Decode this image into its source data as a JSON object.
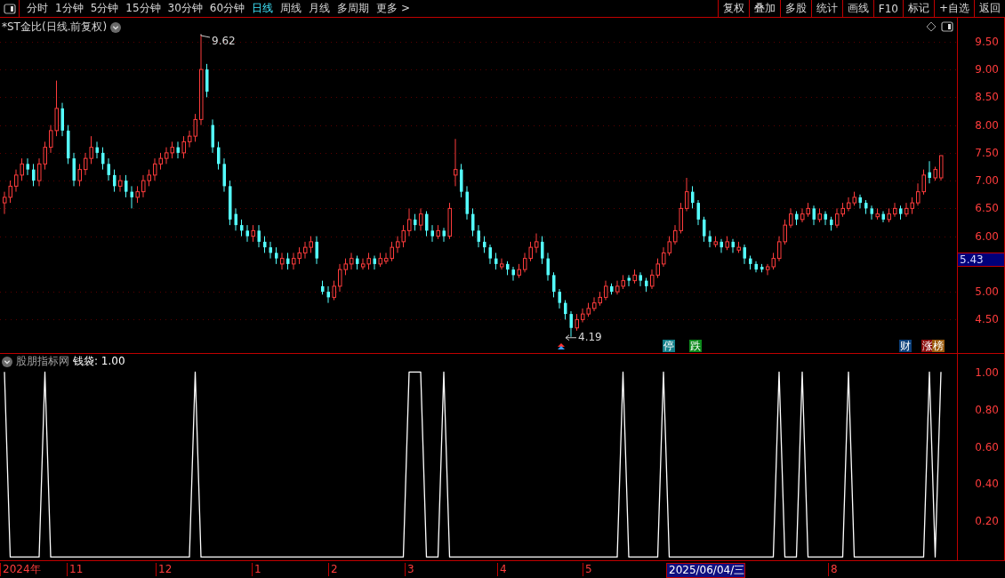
{
  "toolbar": {
    "periods": [
      {
        "label": "分时",
        "selected": false
      },
      {
        "label": "1分钟",
        "selected": false
      },
      {
        "label": "5分钟",
        "selected": false
      },
      {
        "label": "15分钟",
        "selected": false
      },
      {
        "label": "30分钟",
        "selected": false
      },
      {
        "label": "60分钟",
        "selected": false
      },
      {
        "label": "日线",
        "selected": true
      },
      {
        "label": "周线",
        "selected": false
      },
      {
        "label": "月线",
        "selected": false
      },
      {
        "label": "多周期",
        "selected": false
      },
      {
        "label": "更多 >",
        "selected": false
      }
    ],
    "buttons": [
      "复权",
      "叠加",
      "多股",
      "统计",
      "画线",
      "F10",
      "标记",
      "+自选",
      "返回"
    ]
  },
  "main_chart": {
    "title": "*ST金比(日线.前复权)",
    "high_label": "9.62",
    "low_label": "4.19",
    "current_price": "5.43",
    "badges": [
      {
        "label": "停",
        "color": "#12808a"
      },
      {
        "label": "跌",
        "color": "#0d8a1c"
      },
      {
        "label": "财",
        "color": "#0b3f7a"
      },
      {
        "label": "涨",
        "color": "#8a0d0d"
      },
      {
        "label": "榜",
        "color": "#9a5a0c"
      }
    ],
    "chart_data": {
      "type": "candlestick",
      "grid": true,
      "ylim": [
        3.89,
        9.93
      ],
      "yticks": [
        {
          "value": 9.5,
          "label": "9.50"
        },
        {
          "value": 9,
          "label": "9.00"
        },
        {
          "value": 8.5,
          "label": "8.50"
        },
        {
          "value": 8,
          "label": "8.00"
        },
        {
          "value": 7.5,
          "label": "7.50"
        },
        {
          "value": 7,
          "label": "7.00"
        },
        {
          "value": 6.5,
          "label": "6.50"
        },
        {
          "value": 6,
          "label": "6.00"
        },
        {
          "value": 5,
          "label": "5.00"
        },
        {
          "value": 4.5,
          "label": "4.50"
        }
      ],
      "ohlc": [
        [
          6.6,
          6.8,
          6.4,
          6.7
        ],
        [
          6.7,
          7.0,
          6.6,
          6.9
        ],
        [
          6.9,
          7.2,
          6.8,
          7.1
        ],
        [
          7.1,
          7.4,
          7.0,
          7.3
        ],
        [
          7.3,
          7.4,
          7.1,
          7.2
        ],
        [
          7.2,
          7.3,
          6.9,
          7.0
        ],
        [
          7.0,
          7.4,
          6.9,
          7.3
        ],
        [
          7.3,
          7.7,
          7.2,
          7.6
        ],
        [
          7.6,
          8.0,
          7.5,
          7.9
        ],
        [
          7.9,
          8.8,
          7.8,
          8.3
        ],
        [
          8.3,
          8.4,
          7.8,
          7.9
        ],
        [
          7.9,
          8.0,
          7.3,
          7.4
        ],
        [
          7.4,
          7.5,
          6.9,
          7.0
        ],
        [
          7.0,
          7.3,
          6.9,
          7.2
        ],
        [
          7.2,
          7.5,
          7.1,
          7.4
        ],
        [
          7.4,
          7.8,
          7.3,
          7.6
        ],
        [
          7.6,
          7.7,
          7.4,
          7.5
        ],
        [
          7.5,
          7.6,
          7.2,
          7.3
        ],
        [
          7.3,
          7.4,
          7.0,
          7.1
        ],
        [
          7.1,
          7.2,
          6.8,
          6.9
        ],
        [
          6.9,
          7.1,
          6.8,
          7.0
        ],
        [
          7.0,
          7.1,
          6.7,
          6.8
        ],
        [
          6.8,
          6.9,
          6.5,
          6.7
        ],
        [
          6.7,
          6.9,
          6.6,
          6.8
        ],
        [
          6.8,
          7.1,
          6.7,
          7.0
        ],
        [
          7.0,
          7.2,
          6.9,
          7.1
        ],
        [
          7.1,
          7.4,
          7.0,
          7.3
        ],
        [
          7.3,
          7.5,
          7.2,
          7.4
        ],
        [
          7.4,
          7.6,
          7.3,
          7.5
        ],
        [
          7.5,
          7.7,
          7.4,
          7.6
        ],
        [
          7.6,
          7.7,
          7.4,
          7.5
        ],
        [
          7.5,
          7.8,
          7.4,
          7.7
        ],
        [
          7.7,
          7.9,
          7.6,
          7.8
        ],
        [
          7.8,
          8.2,
          7.7,
          8.1
        ],
        [
          8.1,
          9.62,
          8.0,
          9.0
        ],
        [
          9.0,
          9.1,
          8.5,
          8.6
        ],
        [
          8.0,
          8.1,
          7.5,
          7.6
        ],
        [
          7.6,
          7.7,
          7.2,
          7.3
        ],
        [
          7.3,
          7.4,
          6.8,
          6.9
        ],
        [
          6.9,
          7.0,
          6.2,
          6.3
        ],
        [
          6.4,
          6.5,
          6.1,
          6.2
        ],
        [
          6.2,
          6.3,
          6.0,
          6.1
        ],
        [
          6.1,
          6.2,
          5.9,
          6.0
        ],
        [
          6.0,
          6.2,
          5.9,
          6.1
        ],
        [
          6.1,
          6.2,
          5.8,
          5.9
        ],
        [
          5.9,
          6.0,
          5.7,
          5.8
        ],
        [
          5.8,
          5.9,
          5.6,
          5.7
        ],
        [
          5.7,
          5.8,
          5.5,
          5.6
        ],
        [
          5.5,
          5.7,
          5.4,
          5.6
        ],
        [
          5.6,
          5.7,
          5.4,
          5.5
        ],
        [
          5.5,
          5.7,
          5.4,
          5.6
        ],
        [
          5.6,
          5.8,
          5.5,
          5.7
        ],
        [
          5.7,
          5.9,
          5.6,
          5.8
        ],
        [
          5.8,
          6.0,
          5.7,
          5.9
        ],
        [
          5.9,
          6.0,
          5.5,
          5.6
        ],
        [
          5.1,
          5.2,
          4.95,
          5.0
        ],
        [
          5.0,
          5.1,
          4.8,
          4.9
        ],
        [
          4.9,
          5.2,
          4.85,
          5.1
        ],
        [
          5.1,
          5.5,
          5.0,
          5.4
        ],
        [
          5.4,
          5.6,
          5.3,
          5.5
        ],
        [
          5.5,
          5.7,
          5.4,
          5.6
        ],
        [
          5.6,
          5.65,
          5.4,
          5.5
        ],
        [
          5.45,
          5.6,
          5.4,
          5.5
        ],
        [
          5.5,
          5.7,
          5.4,
          5.6
        ],
        [
          5.6,
          5.65,
          5.4,
          5.5
        ],
        [
          5.5,
          5.7,
          5.45,
          5.6
        ],
        [
          5.55,
          5.7,
          5.5,
          5.6
        ],
        [
          5.6,
          5.9,
          5.55,
          5.8
        ],
        [
          5.8,
          6.0,
          5.7,
          5.9
        ],
        [
          5.9,
          6.2,
          5.8,
          6.1
        ],
        [
          6.1,
          6.5,
          6.0,
          6.3
        ],
        [
          6.3,
          6.4,
          6.1,
          6.2
        ],
        [
          6.2,
          6.5,
          6.1,
          6.4
        ],
        [
          6.4,
          6.45,
          6.0,
          6.1
        ],
        [
          6.1,
          6.2,
          5.9,
          6.0
        ],
        [
          6.0,
          6.2,
          5.95,
          6.1
        ],
        [
          6.1,
          6.15,
          5.9,
          6.0
        ],
        [
          6.0,
          6.6,
          5.95,
          6.5
        ],
        [
          7.1,
          7.75,
          6.9,
          7.2
        ],
        [
          7.2,
          7.3,
          6.7,
          6.8
        ],
        [
          6.8,
          6.9,
          6.3,
          6.4
        ],
        [
          6.4,
          6.5,
          6.0,
          6.1
        ],
        [
          6.1,
          6.2,
          5.8,
          5.9
        ],
        [
          5.9,
          6.0,
          5.7,
          5.8
        ],
        [
          5.8,
          5.85,
          5.5,
          5.6
        ],
        [
          5.6,
          5.7,
          5.4,
          5.5
        ],
        [
          5.45,
          5.6,
          5.4,
          5.5
        ],
        [
          5.5,
          5.55,
          5.3,
          5.4
        ],
        [
          5.4,
          5.45,
          5.2,
          5.3
        ],
        [
          5.3,
          5.5,
          5.25,
          5.4
        ],
        [
          5.4,
          5.7,
          5.35,
          5.6
        ],
        [
          5.6,
          5.9,
          5.55,
          5.8
        ],
        [
          5.8,
          6.05,
          5.7,
          5.9
        ],
        [
          5.9,
          6.0,
          5.5,
          5.6
        ],
        [
          5.6,
          5.7,
          5.2,
          5.3
        ],
        [
          5.3,
          5.35,
          4.9,
          5.0
        ],
        [
          5.0,
          5.05,
          4.7,
          4.8
        ],
        [
          4.8,
          4.85,
          4.5,
          4.6
        ],
        [
          4.6,
          4.65,
          4.19,
          4.35
        ],
        [
          4.35,
          4.6,
          4.3,
          4.5
        ],
        [
          4.5,
          4.7,
          4.45,
          4.6
        ],
        [
          4.6,
          4.8,
          4.55,
          4.7
        ],
        [
          4.7,
          4.9,
          4.65,
          4.8
        ],
        [
          4.8,
          5.0,
          4.75,
          4.9
        ],
        [
          4.9,
          5.2,
          4.85,
          5.1
        ],
        [
          5.1,
          5.15,
          4.95,
          5.0
        ],
        [
          5.0,
          5.2,
          4.95,
          5.1
        ],
        [
          5.1,
          5.3,
          5.05,
          5.2
        ],
        [
          5.25,
          5.3,
          5.1,
          5.2
        ],
        [
          5.2,
          5.4,
          5.15,
          5.3
        ],
        [
          5.3,
          5.35,
          5.1,
          5.2
        ],
        [
          5.2,
          5.25,
          5.0,
          5.1
        ],
        [
          5.1,
          5.4,
          5.05,
          5.3
        ],
        [
          5.3,
          5.6,
          5.25,
          5.5
        ],
        [
          5.5,
          5.8,
          5.45,
          5.7
        ],
        [
          5.7,
          6.0,
          5.65,
          5.9
        ],
        [
          5.9,
          6.2,
          5.85,
          6.1
        ],
        [
          6.1,
          6.6,
          6.05,
          6.5
        ],
        [
          6.5,
          7.05,
          6.45,
          6.8
        ],
        [
          6.8,
          6.9,
          6.5,
          6.6
        ],
        [
          6.6,
          6.65,
          6.2,
          6.3
        ],
        [
          6.3,
          6.35,
          5.9,
          6.0
        ],
        [
          6.0,
          6.1,
          5.8,
          5.9
        ],
        [
          5.85,
          6.0,
          5.8,
          5.9
        ],
        [
          5.9,
          5.95,
          5.7,
          5.8
        ],
        [
          5.8,
          6.0,
          5.75,
          5.9
        ],
        [
          5.9,
          5.95,
          5.7,
          5.8
        ],
        [
          5.75,
          5.9,
          5.7,
          5.8
        ],
        [
          5.8,
          5.85,
          5.5,
          5.6
        ],
        [
          5.6,
          5.65,
          5.4,
          5.5
        ],
        [
          5.5,
          5.55,
          5.35,
          5.4
        ],
        [
          5.45,
          5.5,
          5.35,
          5.4
        ],
        [
          5.4,
          5.5,
          5.3,
          5.45
        ],
        [
          5.45,
          5.7,
          5.4,
          5.6
        ],
        [
          5.6,
          6.0,
          5.55,
          5.9
        ],
        [
          5.9,
          6.3,
          5.85,
          6.2
        ],
        [
          6.2,
          6.5,
          6.15,
          6.4
        ],
        [
          6.4,
          6.45,
          6.2,
          6.3
        ],
        [
          6.3,
          6.5,
          6.25,
          6.4
        ],
        [
          6.4,
          6.6,
          6.35,
          6.5
        ],
        [
          6.5,
          6.55,
          6.2,
          6.3
        ],
        [
          6.3,
          6.5,
          6.25,
          6.4
        ],
        [
          6.4,
          6.45,
          6.2,
          6.3
        ],
        [
          6.3,
          6.35,
          6.1,
          6.2
        ],
        [
          6.2,
          6.5,
          6.15,
          6.4
        ],
        [
          6.4,
          6.6,
          6.35,
          6.5
        ],
        [
          6.5,
          6.7,
          6.45,
          6.6
        ],
        [
          6.6,
          6.8,
          6.55,
          6.7
        ],
        [
          6.7,
          6.75,
          6.5,
          6.6
        ],
        [
          6.6,
          6.65,
          6.4,
          6.5
        ],
        [
          6.5,
          6.55,
          6.3,
          6.4
        ],
        [
          6.35,
          6.5,
          6.3,
          6.4
        ],
        [
          6.4,
          6.45,
          6.25,
          6.3
        ],
        [
          6.3,
          6.5,
          6.25,
          6.4
        ],
        [
          6.4,
          6.6,
          6.35,
          6.5
        ],
        [
          6.5,
          6.55,
          6.3,
          6.4
        ],
        [
          6.4,
          6.6,
          6.35,
          6.5
        ],
        [
          6.5,
          6.7,
          6.4,
          6.6
        ],
        [
          6.6,
          6.95,
          6.55,
          6.8
        ],
        [
          6.8,
          7.2,
          6.75,
          7.1
        ],
        [
          7.15,
          7.35,
          6.95,
          7.05
        ],
        [
          7.05,
          7.25,
          7.0,
          7.2
        ],
        [
          7.05,
          7.45,
          7.0,
          7.45
        ]
      ]
    }
  },
  "indicator": {
    "source": "股朋指标网",
    "reading": "钱袋: 1.00",
    "chart_data": {
      "type": "line",
      "ylim": [
        -0.01,
        1.1
      ],
      "yticks": [
        {
          "value": 1,
          "label": "1.00"
        },
        {
          "value": 0.8,
          "label": "0.80"
        },
        {
          "value": 0.6,
          "label": "0.60"
        },
        {
          "value": 0.4,
          "label": "0.40"
        },
        {
          "value": 0.2,
          "label": "0.20"
        }
      ],
      "series": [
        {
          "color": "#ffffff",
          "values": [
            1,
            0,
            0,
            0,
            0,
            0,
            0,
            1,
            0,
            0,
            0,
            0,
            0,
            0,
            0,
            0,
            0,
            0,
            0,
            0,
            0,
            0,
            0,
            0,
            0,
            0,
            0,
            0,
            0,
            0,
            0,
            0,
            0,
            1,
            0,
            0,
            0,
            0,
            0,
            0,
            0,
            0,
            0,
            0,
            0,
            0,
            0,
            0,
            0,
            0,
            0,
            0,
            0,
            0,
            0,
            0,
            0,
            0,
            0,
            0,
            0,
            0,
            0,
            0,
            0,
            0,
            0,
            0,
            0,
            0,
            1,
            1,
            1,
            0,
            0,
            0,
            1,
            0,
            0,
            0,
            0,
            0,
            0,
            0,
            0,
            0,
            0,
            0,
            0,
            0,
            0,
            0,
            0,
            0,
            0,
            0,
            0,
            0,
            0,
            0,
            0,
            0,
            0,
            0,
            0,
            0,
            0,
            1,
            0,
            0,
            0,
            0,
            0,
            0,
            1,
            0,
            0,
            0,
            0,
            0,
            0,
            0,
            0,
            0,
            0,
            0,
            0,
            0,
            0,
            0,
            0,
            0,
            0,
            0,
            1,
            0,
            0,
            0,
            1,
            0,
            0,
            0,
            0,
            0,
            0,
            0,
            1,
            0,
            0,
            0,
            0,
            0,
            0,
            0,
            0,
            0,
            0,
            0,
            0,
            0,
            1,
            0,
            1
          ]
        }
      ]
    }
  },
  "time_axis": [
    {
      "label": "2024年",
      "highlighted": false
    },
    {
      "label": "11",
      "highlighted": false
    },
    {
      "label": "12",
      "highlighted": false
    },
    {
      "label": "1",
      "highlighted": false
    },
    {
      "label": "2",
      "highlighted": false
    },
    {
      "label": "3",
      "highlighted": false
    },
    {
      "label": "4",
      "highlighted": false
    },
    {
      "label": "5",
      "highlighted": false
    },
    {
      "label": "2025/06/04/三",
      "highlighted": true
    },
    {
      "label": "8",
      "highlighted": false
    }
  ]
}
